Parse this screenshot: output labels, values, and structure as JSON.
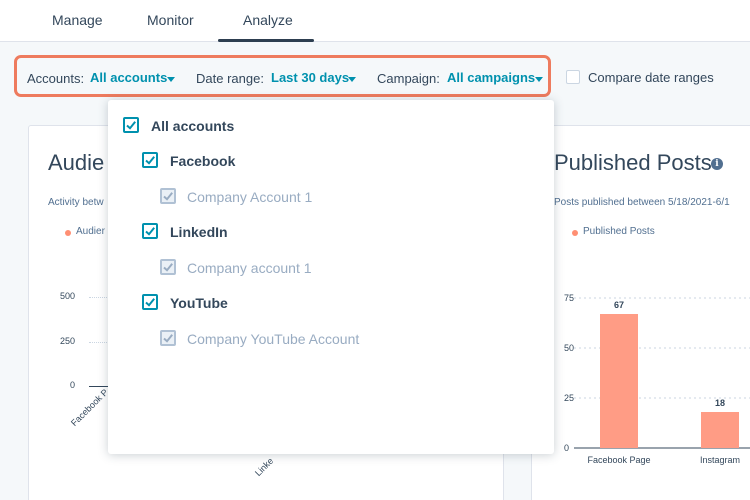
{
  "tabs": [
    {
      "label": "Manage"
    },
    {
      "label": "Monitor"
    },
    {
      "label": "Analyze",
      "active": true
    }
  ],
  "filters": {
    "accounts_label": "Accounts:",
    "accounts_value": "All accounts",
    "date_label": "Date range:",
    "date_value": "Last 30 days",
    "campaign_label": "Campaign:",
    "campaign_value": "All campaigns",
    "compare_label": "Compare date ranges"
  },
  "audience_card": {
    "title": "Audie",
    "subtitle": "Activity betw",
    "legend": "Audier",
    "y_ticks": [
      "500",
      "250",
      "0"
    ],
    "x_ticks": [
      "Facebook P",
      "Linke"
    ]
  },
  "posts_card": {
    "title": "Published Posts",
    "info_icon": "i",
    "subtitle": "Posts published between 5/18/2021-6/1",
    "legend": "Published Posts"
  },
  "chart_data": {
    "type": "bar",
    "title": "Published Posts",
    "categories": [
      "Facebook Page",
      "Instagram"
    ],
    "series": [
      {
        "name": "Published Posts",
        "values": [
          67,
          18
        ]
      }
    ],
    "ylim": [
      0,
      75
    ],
    "y_ticks": [
      0,
      25,
      50,
      75
    ],
    "grid": true,
    "legend": "top-left"
  },
  "dropdown": {
    "all_label": "All accounts",
    "groups": [
      {
        "label": "Facebook",
        "child": "Company Account 1"
      },
      {
        "label": "LinkedIn",
        "child": "Company account 1"
      },
      {
        "label": "YouTube",
        "child": "Company YouTube Account"
      }
    ]
  },
  "colors": {
    "accent": "#0091ae",
    "highlight_border": "#ee7b5e",
    "bar": "#ff9c85",
    "text": "#33475b"
  }
}
